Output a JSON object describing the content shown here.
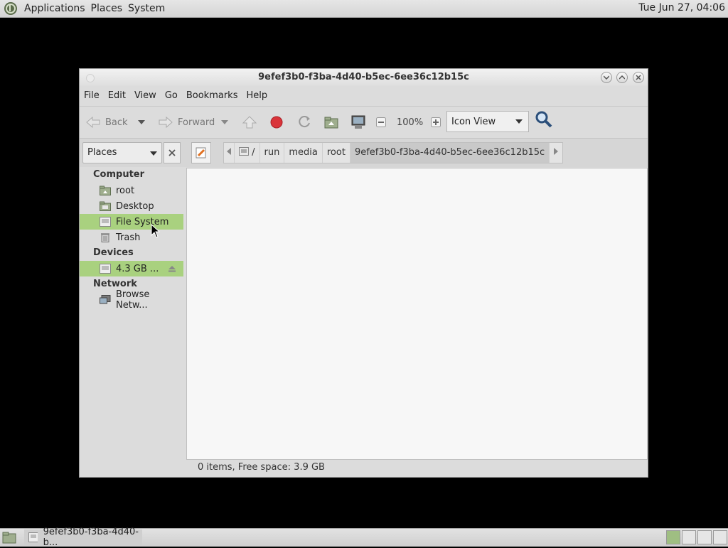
{
  "top_panel": {
    "menus": [
      "Applications",
      "Places",
      "System"
    ],
    "clock": "Tue Jun 27, 04:06"
  },
  "window": {
    "title": "9efef3b0-f3ba-4d40-b5ec-6ee36c12b15c",
    "menubar": [
      "File",
      "Edit",
      "View",
      "Go",
      "Bookmarks",
      "Help"
    ],
    "toolbar": {
      "back": "Back",
      "forward": "Forward",
      "zoom": "100%",
      "view_mode": "Icon View"
    },
    "location": {
      "places_label": "Places",
      "crumbs": [
        "/",
        "run",
        "media",
        "root",
        "9efef3b0-f3ba-4d40-b5ec-6ee36c12b15c"
      ]
    },
    "sidebar": {
      "computer_label": "Computer",
      "computer_items": [
        "root",
        "Desktop",
        "File System",
        "Trash"
      ],
      "devices_label": "Devices",
      "device_items": [
        "4.3 GB ..."
      ],
      "network_label": "Network",
      "network_items": [
        "Browse Netw..."
      ]
    },
    "status": "0 items, Free space: 3.9 GB"
  },
  "taskbar": {
    "task_title": "9efef3b0-f3ba-4d40-b..."
  },
  "colors": {
    "selection": "#a9d17f",
    "stop": "#d9343a"
  }
}
